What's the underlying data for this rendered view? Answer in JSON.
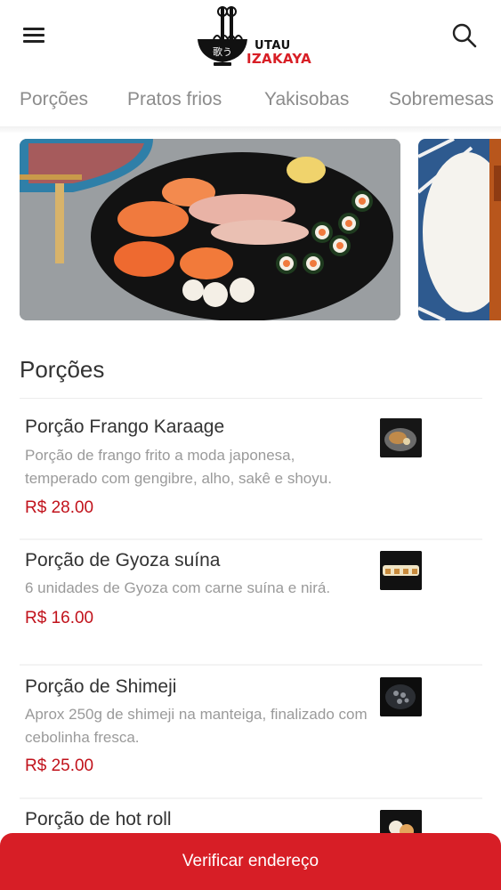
{
  "brand": {
    "name_top": "UTAU",
    "name_bottom": "IZAKAYA",
    "logo_glyph": "歌う",
    "accent_color": "#d71e26"
  },
  "header": {
    "menu_icon": "hamburger-menu-icon",
    "search_icon": "search-icon"
  },
  "tabs": [
    {
      "label": "Porções"
    },
    {
      "label": "Pratos frios"
    },
    {
      "label": "Yakisobas"
    },
    {
      "label": "Sobremesas"
    }
  ],
  "section": {
    "title": "Porções"
  },
  "items": [
    {
      "name": "Porção Frango Karaage",
      "description": "Porção de frango frito a moda japonesa, temperado com gengibre, alho, sakê e shoyu.",
      "price": "R$ 28.00"
    },
    {
      "name": "Porção de Gyoza suína",
      "description": "6 unidades de Gyoza com carne suína e nirá.",
      "price": "R$ 16.00"
    },
    {
      "name": "Porção de Shimeji",
      "description": "Aprox 250g de shimeji na manteiga, finalizado com cebolinha fresca.",
      "price": "R$ 25.00"
    },
    {
      "name": "Porção de hot roll",
      "description": "",
      "price": ""
    }
  ],
  "footer": {
    "cta_label": "Verificar endereço"
  }
}
